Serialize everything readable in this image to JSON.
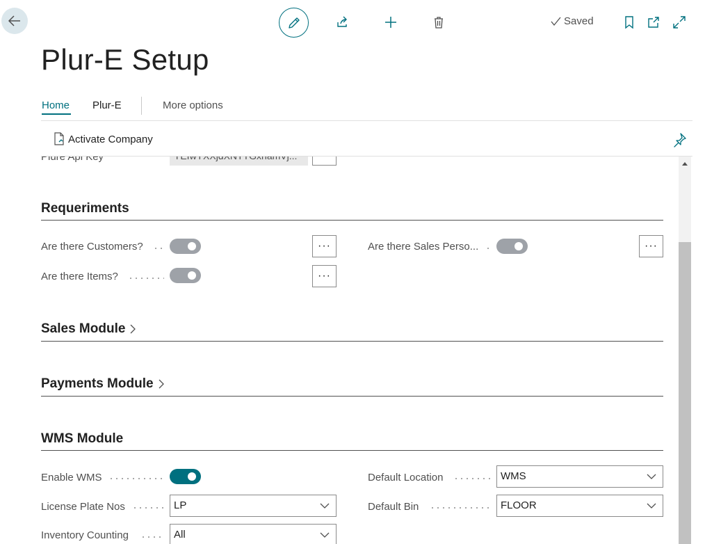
{
  "toolbar": {
    "saved_label": "Saved"
  },
  "page": {
    "title": "Plur-E Setup"
  },
  "tabs": [
    {
      "label": "Home"
    },
    {
      "label": "Plur-E"
    },
    {
      "label": "More options"
    }
  ],
  "actions": {
    "activate_company": "Activate Company"
  },
  "partial_field": {
    "label": "Plure Api Key",
    "value": "YEIwYXXjdXNTTGxhamVj..."
  },
  "sections": {
    "requirements": {
      "title": "Requeriments",
      "customers_label": "Are there Customers?",
      "sales_persons_label": "Are there Sales Perso...",
      "items_label": "Are there Items?"
    },
    "sales": {
      "title": "Sales Module"
    },
    "payments": {
      "title": "Payments Module"
    },
    "wms": {
      "title": "WMS Module",
      "enable_label": "Enable WMS",
      "license_label": "License Plate Nos",
      "license_value": "LP",
      "inventory_label": "Inventory Counting",
      "inventory_value": "All",
      "location_label": "Default Location",
      "location_value": "WMS",
      "bin_label": "Default Bin",
      "bin_value": "FLOOR"
    }
  },
  "ellipsis": "···",
  "colors": {
    "accent": "#00707f",
    "toggle_off": "#9ea2a8"
  }
}
